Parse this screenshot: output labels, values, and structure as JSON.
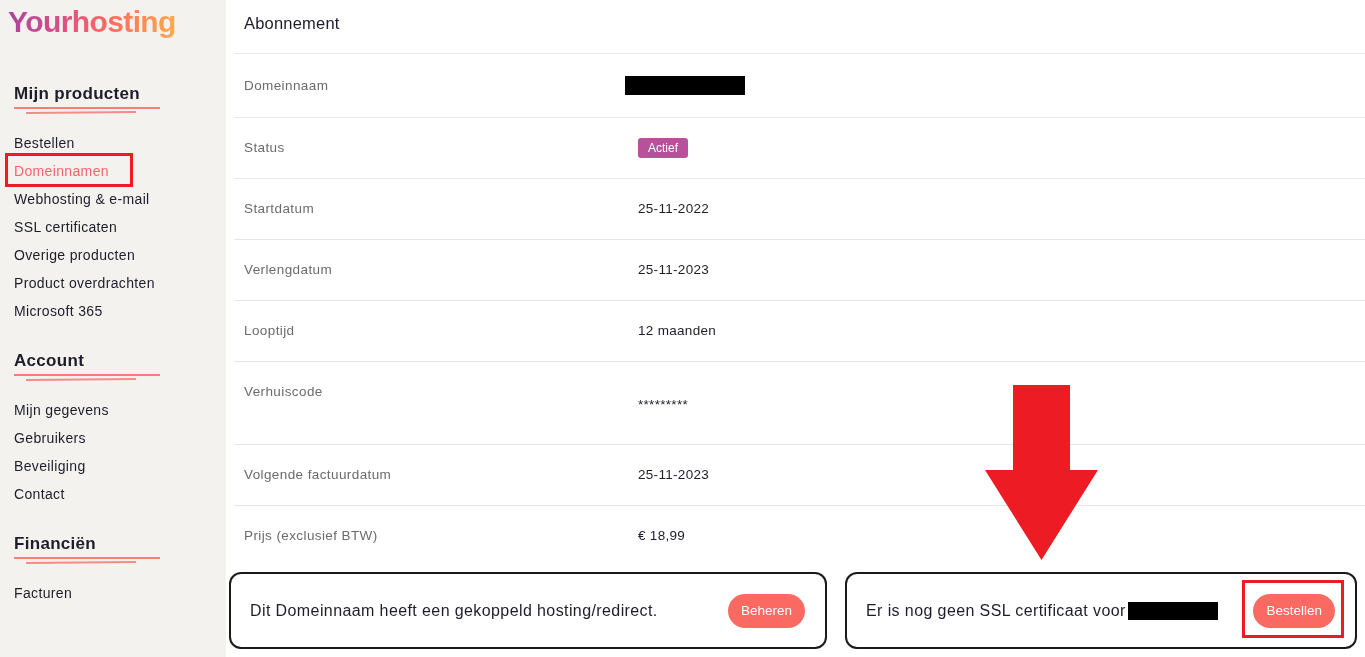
{
  "logo": {
    "text": "Yourhosting"
  },
  "sidebar": {
    "sections": [
      {
        "heading": "Mijn producten",
        "items": [
          {
            "label": "Bestellen",
            "selected": false,
            "highlighted": false
          },
          {
            "label": "Domeinnamen",
            "selected": true,
            "highlighted": true
          },
          {
            "label": "Webhosting & e-mail",
            "selected": false,
            "highlighted": false
          },
          {
            "label": "SSL certificaten",
            "selected": false,
            "highlighted": false
          },
          {
            "label": "Overige producten",
            "selected": false,
            "highlighted": false
          },
          {
            "label": "Product overdrachten",
            "selected": false,
            "highlighted": false
          },
          {
            "label": "Microsoft 365",
            "selected": false,
            "highlighted": false
          }
        ]
      },
      {
        "heading": "Account",
        "items": [
          {
            "label": "Mijn gegevens",
            "selected": false,
            "highlighted": false
          },
          {
            "label": "Gebruikers",
            "selected": false,
            "highlighted": false
          },
          {
            "label": "Beveiliging",
            "selected": false,
            "highlighted": false
          },
          {
            "label": "Contact",
            "selected": false,
            "highlighted": false
          }
        ]
      },
      {
        "heading": "Financiën",
        "items": [
          {
            "label": "Facturen",
            "selected": false,
            "highlighted": false
          }
        ]
      }
    ]
  },
  "subscription": {
    "title": "Abonnement",
    "rows": [
      {
        "label": "Domeinnaam",
        "kind": "redacted"
      },
      {
        "label": "Status",
        "kind": "badge",
        "value": "Actief"
      },
      {
        "label": "Startdatum",
        "kind": "text",
        "value": "25-11-2022"
      },
      {
        "label": "Verlengdatum",
        "kind": "text",
        "value": "25-11-2023"
      },
      {
        "label": "Looptijd",
        "kind": "text",
        "value": "12 maanden"
      },
      {
        "label": "Verhuiscode",
        "kind": "masked",
        "value": "*********"
      },
      {
        "label": "Volgende factuurdatum",
        "kind": "text",
        "value": "25-11-2023"
      },
      {
        "label": "Prijs (exclusief BTW)",
        "kind": "text",
        "value": "€ 18,99"
      }
    ]
  },
  "notices": [
    {
      "text": "Dit Domeinnaam heeft een gekoppeld hosting/redirect.",
      "redacted_suffix": false,
      "button": {
        "label": "Beheren",
        "highlighted": false
      }
    },
    {
      "text": "Er is nog geen SSL certificaat voor",
      "redacted_suffix": true,
      "button": {
        "label": "Bestellen",
        "highlighted": true
      }
    }
  ],
  "annotation_arrow": true
}
